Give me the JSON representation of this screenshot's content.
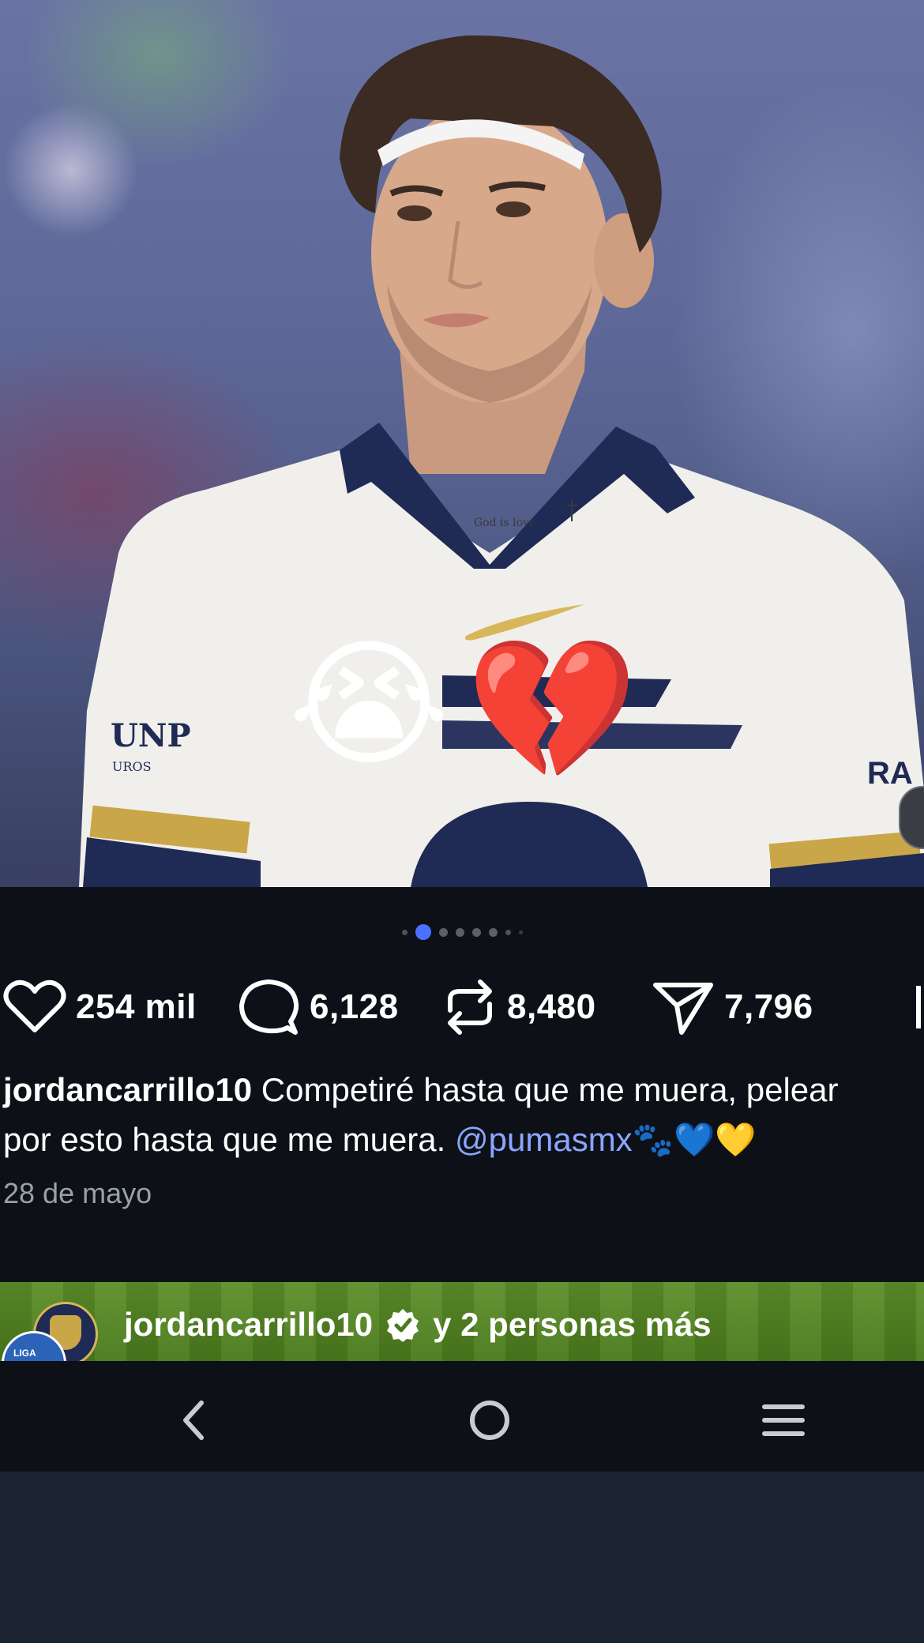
{
  "photo": {
    "emoji_crying": "😭",
    "emoji_broken_heart": "💔",
    "neck_tattoo_text": "God is love",
    "sponsor_text": "UNP",
    "sponsor_sub": "UROS",
    "sleeve_text": "RA"
  },
  "carousel": {
    "total_dots": 7,
    "active_index": 1
  },
  "actions": {
    "likes": "254 mil",
    "comments": "6,128",
    "reposts": "8,480",
    "shares": "7,796"
  },
  "post": {
    "username": "jordancarrillo10",
    "caption_line1": "Competiré hasta que me muera, pelear",
    "caption_line2_text": "por esto hasta que me muera.",
    "mention": "@pumasmx",
    "caption_emojis": "🐾💙💛",
    "date": "28 de mayo"
  },
  "next_post": {
    "username": "jordancarrillo10",
    "others": "y 2 personas más",
    "avatar_badge": "LIGA"
  },
  "colors": {
    "background": "#0d1117",
    "accent_dot": "#4a70ff",
    "mention": "#8aa6ff",
    "muted_text": "#9aa0a8"
  },
  "icons": [
    "heart-icon",
    "comment-icon",
    "repost-icon",
    "share-icon",
    "save-icon",
    "verified-icon",
    "back-icon",
    "home-icon",
    "menu-icon"
  ]
}
